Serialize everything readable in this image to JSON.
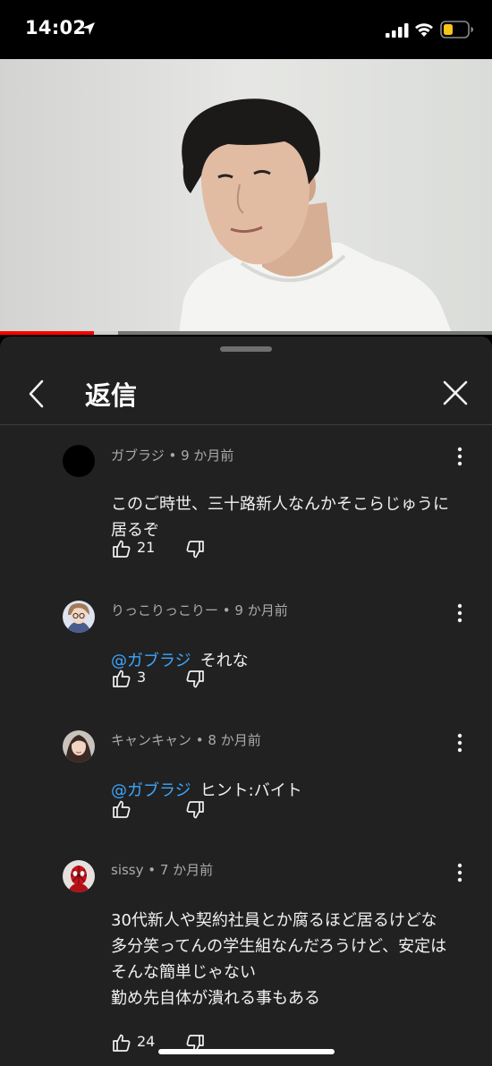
{
  "status_bar": {
    "time": "14:02",
    "icons": [
      "location-arrow-icon",
      "cellular-signal-icon",
      "wifi-icon",
      "battery-icon"
    ],
    "battery_color": "#f5c518"
  },
  "video": {
    "progress_played": 0.19,
    "progress_buffered": 0.24,
    "progress_color": "#ff0000"
  },
  "panel": {
    "title": "返信",
    "back_icon": "chevron-left-icon",
    "close_icon": "close-icon"
  },
  "comments": [
    {
      "meta": "ガブラジ • 9 か月前",
      "mention": "",
      "text": "このご時世、三十路新人なんかそこらじゅうに居るぞ",
      "likes": "21"
    },
    {
      "meta": "りっこりっこりー • 9 か月前",
      "mention": "@ガブラジ",
      "text": "それな",
      "likes": "3"
    },
    {
      "meta": "キャンキャン • 8 か月前",
      "mention": "@ガブラジ",
      "text": "ヒント:バイト",
      "likes": ""
    },
    {
      "meta": "sissy • 7 か月前",
      "mention": "",
      "text": "30代新人や契約社員とか腐るほど居るけどな\n多分笑ってんの学生組なんだろうけど、安定はそんな簡単じゃない\n勤め先自体が潰れる事もある",
      "likes": "24"
    }
  ],
  "colors": {
    "panel_bg": "#212121",
    "mention": "#3ea6ff",
    "meta_text": "#aaaaaa"
  }
}
